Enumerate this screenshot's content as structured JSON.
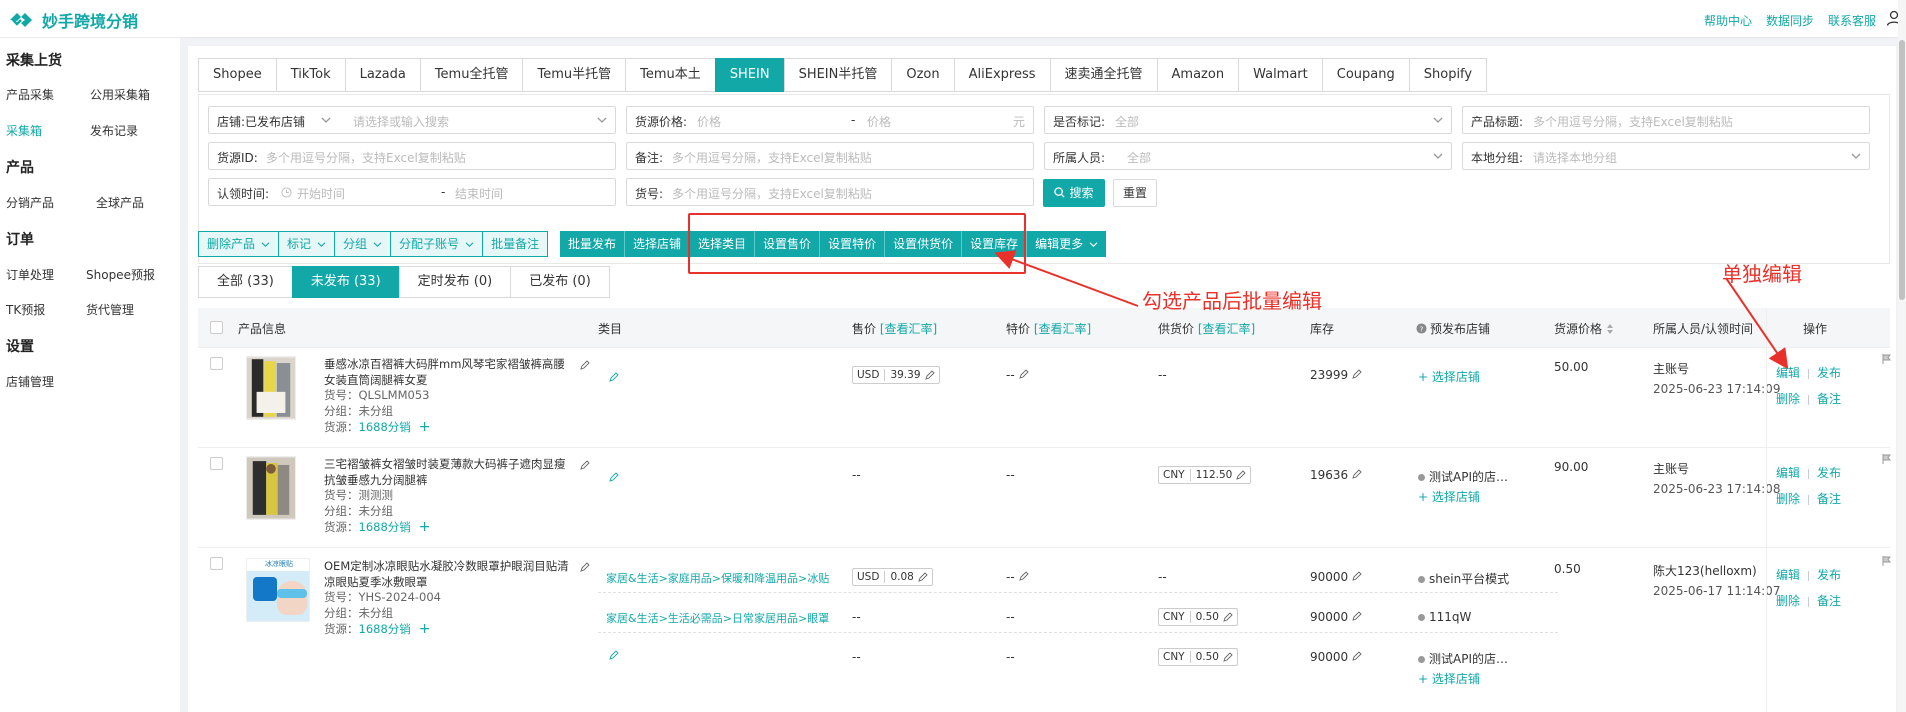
{
  "app": {
    "title": "妙手跨境分销",
    "brand_color": "#13a8a8",
    "top_links": [
      "帮助中心",
      "数据同步",
      "联系客服"
    ]
  },
  "sidebar": {
    "groups": [
      {
        "title": "采集上货",
        "items": [
          "产品采集",
          "公用采集箱",
          "采集箱",
          "发布记录"
        ]
      },
      {
        "title": "产品",
        "items": [
          "分销产品",
          "全球产品"
        ]
      },
      {
        "title": "订单",
        "items": [
          "订单处理",
          "Shopee预报",
          "TK预报",
          "货代管理"
        ]
      },
      {
        "title": "设置",
        "items": [
          "店铺管理"
        ]
      }
    ],
    "active_item": "采集箱"
  },
  "platform_tabs": [
    "Shopee",
    "TikTok",
    "Lazada",
    "Temu全托管",
    "Temu半托管",
    "Temu本土",
    "SHEIN",
    "SHEIN半托管",
    "Ozon",
    "AliExpress",
    "速卖通全托管",
    "Amazon",
    "Walmart",
    "Coupang",
    "Shopify"
  ],
  "active_platform": "SHEIN",
  "filters": {
    "store": {
      "label": "店铺:",
      "value": "已发布店铺",
      "placeholder": "请选择或输入搜索"
    },
    "source_price": {
      "label": "货源价格:",
      "min_placeholder": "价格",
      "dash": "-",
      "max_placeholder": "价格",
      "unit": "元"
    },
    "marked": {
      "label": "是否标记:",
      "value": "全部"
    },
    "title": {
      "label": "产品标题:",
      "placeholder": "多个用逗号分隔，支持Excel复制粘贴"
    },
    "source_id": {
      "label": "货源ID:",
      "placeholder": "多个用逗号分隔，支持Excel复制粘贴"
    },
    "remark": {
      "label": "备注:",
      "placeholder": "多个用逗号分隔，支持Excel复制粘贴"
    },
    "owner": {
      "label": "所属人员:",
      "value": "全部"
    },
    "local_group": {
      "label": "本地分组:",
      "placeholder": "请选择本地分组"
    },
    "claim_time": {
      "label": "认领时间:",
      "start_placeholder": "开始时间",
      "dash": "-",
      "end_placeholder": "结束时间"
    },
    "sku": {
      "label": "货号:",
      "placeholder": "多个用逗号分隔，支持Excel复制粘贴"
    },
    "search_button": "搜索",
    "reset_button": "重置"
  },
  "actions_left": [
    "删除产品",
    "标记",
    "分组",
    "分配子账号",
    "批量备注"
  ],
  "actions_right": [
    "批量发布",
    "选择店铺",
    "选择类目",
    "设置售价",
    "设置特价",
    "设置供货价",
    "设置库存",
    "编辑更多"
  ],
  "status_tabs": [
    "全部 (33)",
    "未发布 (33)",
    "定时发布 (0)",
    "已发布 (0)"
  ],
  "active_status": "未发布 (33)",
  "table": {
    "headers": {
      "product": "产品信息",
      "category": "类目",
      "price": "售价",
      "special": "特价",
      "supply": "供货价",
      "rate_link": "[查看汇率]",
      "stock": "库存",
      "pre_store": "预发布店铺",
      "source_price": "货源价格",
      "owner": "所属人员/认领时间",
      "ops": "操作"
    },
    "rows": [
      {
        "title": "垂感冰凉百褶裤大码胖mm风琴宅家褶皱裤高腰女装直筒阔腿裤女夏",
        "sku": "货号：QLSLMM053",
        "group": "分组：未分组",
        "source_label": "货源：",
        "source": "1688分销",
        "category": "",
        "price_currency": "USD",
        "price": "39.39",
        "special": "--",
        "supply": "--",
        "stock": "23999",
        "store": "",
        "select_store": "选择店铺",
        "source_price": "50.00",
        "owner": "主账号",
        "time": "2025-06-23 17:14:09"
      },
      {
        "title": "三宅褶皱裤女褶皱时装夏薄款大码裤子遮肉显瘦抗皱垂感九分阔腿裤",
        "sku": "货号：测测测",
        "group": "分组：未分组",
        "source_label": "货源：",
        "source": "1688分销",
        "category": "",
        "price": "--",
        "special": "--",
        "supply_currency": "CNY",
        "supply": "112.50",
        "stock": "19636",
        "store": "测试API的店…",
        "select_store": "选择店铺",
        "source_price": "90.00",
        "owner": "主账号",
        "time": "2025-06-23 17:14:08"
      },
      {
        "title": "OEM定制冰凉眼贴水凝胶冷数眼罩护眼润目贴清凉眼贴夏季冰敷眼罩",
        "sku": "货号：YHS-2024-004",
        "group": "分组：未分组",
        "source_label": "货源：",
        "source": "1688分销",
        "source_price": "0.50",
        "owner": "陈大123(helloxm)",
        "time": "2025-06-17 11:14:07",
        "thumb_text": "冰凉眼贴",
        "subs": [
          {
            "category": "家居&生活>家庭用品>保暖和降温用品>冰贴",
            "price_currency": "USD",
            "price": "0.08",
            "special": "--",
            "supply": "--",
            "stock": "90000",
            "store": "shein平台模式"
          },
          {
            "category": "家居&生活>生活必需品>日常家居用品>眼罩",
            "price": "--",
            "special": "--",
            "supply_currency": "CNY",
            "supply": "0.50",
            "stock": "90000",
            "store": "111qW"
          },
          {
            "category": "",
            "price": "--",
            "special": "--",
            "supply_currency": "CNY",
            "supply": "0.50",
            "stock": "90000",
            "store": "测试API的店…",
            "select_store": "选择店铺"
          }
        ]
      }
    ],
    "ops": {
      "edit": "编辑",
      "publish": "发布",
      "delete": "删除",
      "remark": "备注"
    }
  },
  "annotations": {
    "batch_edit": "勾选产品后批量编辑",
    "single_edit": "单独编辑",
    "color": "#e8312a"
  }
}
